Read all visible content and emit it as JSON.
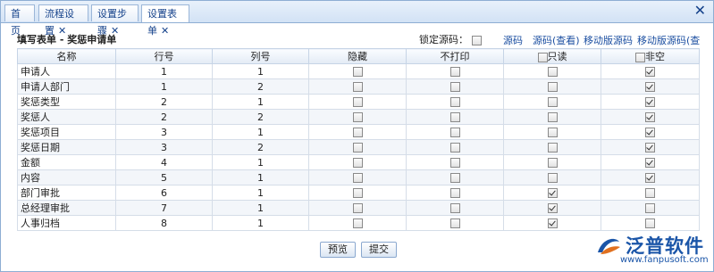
{
  "tabs": [
    {
      "label": "首页",
      "closable": false
    },
    {
      "label": "流程设置",
      "closable": true
    },
    {
      "label": "设置步骤",
      "closable": true
    },
    {
      "label": "设置表单",
      "closable": true,
      "active": true
    }
  ],
  "close_glyph": "✕",
  "form_title": "填写表单 - 奖惩申请单",
  "lock": {
    "label": "锁定源码：",
    "checked": false
  },
  "links": [
    "源码",
    "源码(查看)",
    "移动版源码",
    "移动版源码(查看)"
  ],
  "columns": {
    "name": "名称",
    "row": "行号",
    "col": "列号",
    "hidden": "隐藏",
    "noprint": "不打印",
    "readonly": "只读",
    "required": "非空"
  },
  "header_checks": {
    "readonly": false,
    "required": false
  },
  "rows": [
    {
      "name": "申请人",
      "row": "1",
      "col": "1",
      "hidden": false,
      "noprint": false,
      "readonly": false,
      "required": true
    },
    {
      "name": "申请人部门",
      "row": "1",
      "col": "2",
      "hidden": false,
      "noprint": false,
      "readonly": false,
      "required": true
    },
    {
      "name": "奖惩类型",
      "row": "2",
      "col": "1",
      "hidden": false,
      "noprint": false,
      "readonly": false,
      "required": true
    },
    {
      "name": "奖惩人",
      "row": "2",
      "col": "2",
      "hidden": false,
      "noprint": false,
      "readonly": false,
      "required": true
    },
    {
      "name": "奖惩项目",
      "row": "3",
      "col": "1",
      "hidden": false,
      "noprint": false,
      "readonly": false,
      "required": true
    },
    {
      "name": "奖惩日期",
      "row": "3",
      "col": "2",
      "hidden": false,
      "noprint": false,
      "readonly": false,
      "required": true
    },
    {
      "name": "金额",
      "row": "4",
      "col": "1",
      "hidden": false,
      "noprint": false,
      "readonly": false,
      "required": true
    },
    {
      "name": "内容",
      "row": "5",
      "col": "1",
      "hidden": false,
      "noprint": false,
      "readonly": false,
      "required": true
    },
    {
      "name": "部门审批",
      "row": "6",
      "col": "1",
      "hidden": false,
      "noprint": false,
      "readonly": true,
      "required": false
    },
    {
      "name": "总经理审批",
      "row": "7",
      "col": "1",
      "hidden": false,
      "noprint": false,
      "readonly": true,
      "required": false
    },
    {
      "name": "人事归档",
      "row": "8",
      "col": "1",
      "hidden": false,
      "noprint": false,
      "readonly": true,
      "required": false
    }
  ],
  "buttons": {
    "preview": "预览",
    "submit": "提交"
  },
  "logo": {
    "brand": "泛普软件",
    "site": "www.fanpusoft.com",
    "color": "#1a55a8"
  }
}
